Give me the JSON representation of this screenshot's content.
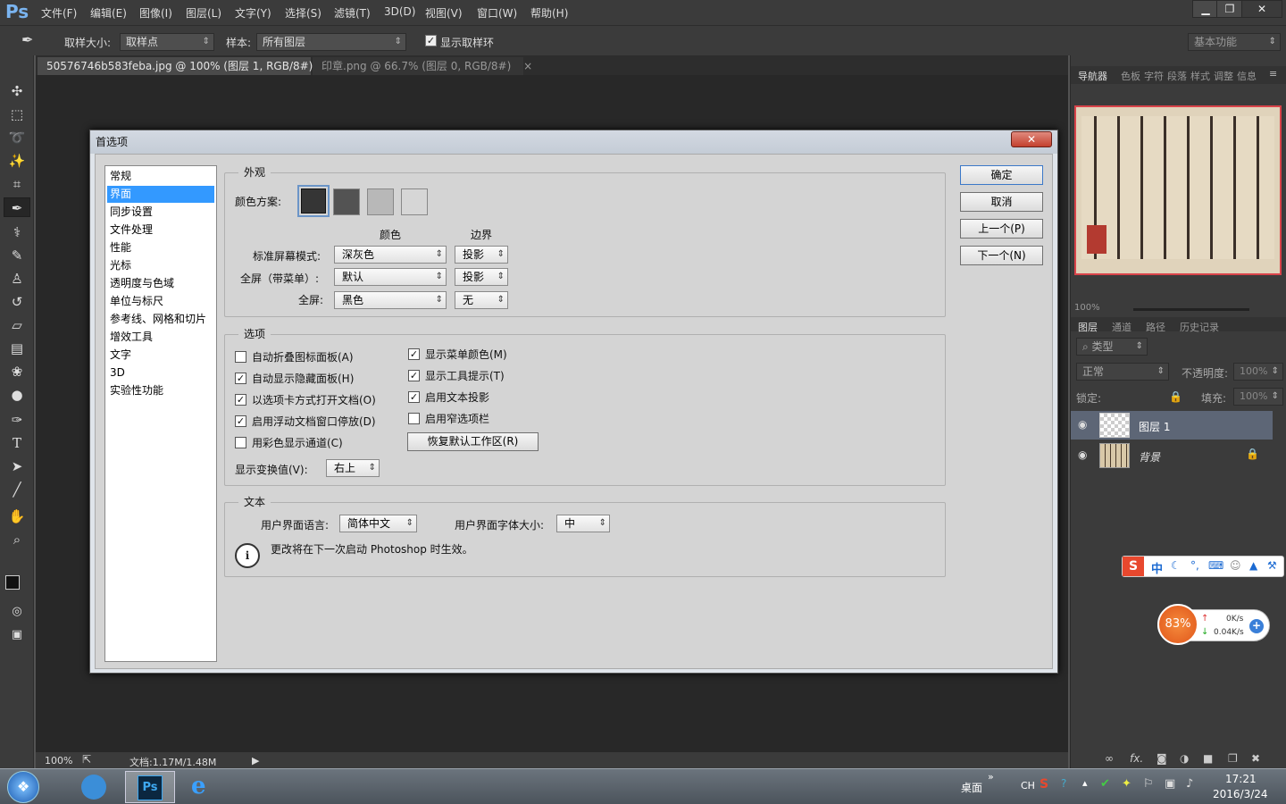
{
  "app": {
    "logo": "Ps"
  },
  "menu": [
    "文件(F)",
    "编辑(E)",
    "图像(I)",
    "图层(L)",
    "文字(Y)",
    "选择(S)",
    "滤镜(T)",
    "3D(D)",
    "视图(V)",
    "窗口(W)",
    "帮助(H)"
  ],
  "window_controls": {
    "minimize": "▁",
    "restore": "❐",
    "close": "✕"
  },
  "options_bar": {
    "sample_size_label": "取样大小:",
    "sample_size_value": "取样点",
    "sample_label": "样本:",
    "sample_value": "所有图层",
    "show_ring_label": "显示取样环",
    "show_ring_checked": "✓",
    "workspace": "基本功能"
  },
  "doc_tabs": [
    {
      "title": "50576746b583feba.jpg @ 100% (图层 1, RGB/8#) *",
      "close": "×"
    },
    {
      "title": "印章.png @ 66.7% (图层 0, RGB/8#)",
      "close": "×"
    }
  ],
  "status": {
    "zoom": "100%",
    "doc": "文档:1.17M/1.48M",
    "arrow": "▶"
  },
  "dialog": {
    "title": "首选项",
    "close": "✕",
    "categories": [
      "常规",
      "界面",
      "同步设置",
      "文件处理",
      "性能",
      "光标",
      "透明度与色域",
      "单位与标尺",
      "参考线、网格和切片",
      "增效工具",
      "文字",
      "3D",
      "实验性功能"
    ],
    "selected_category": "界面",
    "appearance": {
      "title": "外观",
      "color_scheme_label": "颜色方案:",
      "col_color": "颜色",
      "col_border": "边界",
      "rows": [
        {
          "label": "标准屏幕模式:",
          "color": "深灰色",
          "border": "投影"
        },
        {
          "label": "全屏（带菜单）:",
          "color": "默认",
          "border": "投影"
        },
        {
          "label": "全屏:",
          "color": "黑色",
          "border": "无"
        }
      ]
    },
    "options": {
      "title": "选项",
      "left": [
        {
          "label": "自动折叠图标面板(A)",
          "check": ""
        },
        {
          "label": "自动显示隐藏面板(H)",
          "check": "✓"
        },
        {
          "label": "以选项卡方式打开文档(O)",
          "check": "✓"
        },
        {
          "label": "启用浮动文档窗口停放(D)",
          "check": "✓"
        },
        {
          "label": "用彩色显示通道(C)",
          "check": ""
        }
      ],
      "right": [
        {
          "label": "显示菜单颜色(M)",
          "check": "✓"
        },
        {
          "label": "显示工具提示(T)",
          "check": "✓"
        },
        {
          "label": "启用文本投影",
          "check": "✓"
        },
        {
          "label": "启用窄选项栏",
          "check": ""
        }
      ],
      "reset_button": "恢复默认工作区(R)",
      "transform_label": "显示变换值(V):",
      "transform_value": "右上"
    },
    "text": {
      "title": "文本",
      "lang_label": "用户界面语言:",
      "lang_value": "简体中文",
      "fontsize_label": "用户界面字体大小:",
      "fontsize_value": "中",
      "info_icon": "i",
      "note": "更改将在下一次启动 Photoshop 时生效。"
    },
    "buttons": {
      "ok": "确定",
      "cancel": "取消",
      "prev": "上一个(P)",
      "next": "下一个(N)"
    }
  },
  "right_panel": {
    "nav_tabs": [
      "导航器",
      "色板",
      "字符",
      "段落",
      "样式",
      "调整",
      "信息"
    ],
    "nav_zoom": "100%",
    "layer_tabs": [
      "图层",
      "通道",
      "路径",
      "历史记录"
    ],
    "filter": "类型",
    "blend": "正常",
    "opacity_label": "不透明度:",
    "opacity": "100%",
    "lock_label": "锁定:",
    "fill_label": "填充:",
    "fill": "100%",
    "layers": [
      {
        "name": "图层 1"
      },
      {
        "name": "背景"
      }
    ]
  },
  "ime": {
    "label": "中"
  },
  "netmon": {
    "percent": "83%",
    "up": "0K/s",
    "down": "0.04K/s"
  },
  "taskbar": {
    "desktop": "桌面",
    "lang": "CH",
    "time": "17:21",
    "date": "2016/3/24"
  }
}
